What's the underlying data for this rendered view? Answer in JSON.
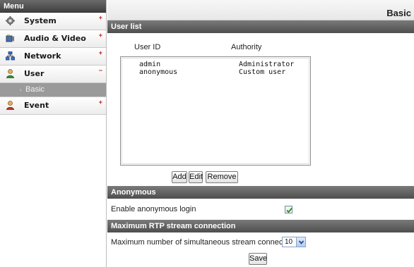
{
  "menu": {
    "header": "Menu",
    "items": [
      {
        "label": "System",
        "sign": "+",
        "icon": "gear-icon"
      },
      {
        "label": "Audio & Video",
        "sign": "+",
        "icon": "video-icon"
      },
      {
        "label": "Network",
        "sign": "+",
        "icon": "network-icon"
      },
      {
        "label": "User",
        "sign": "−",
        "icon": "user-icon"
      },
      {
        "label": "Event",
        "sign": "+",
        "icon": "event-icon"
      }
    ],
    "submenu": {
      "label": "Basic",
      "arrow": "›"
    }
  },
  "page": {
    "title": "Basic"
  },
  "user_list": {
    "section_title": "User list",
    "col_userid": "User ID",
    "col_authority": "Authority",
    "rows": [
      {
        "user_id": "admin",
        "authority": "Administrator"
      },
      {
        "user_id": "anonymous",
        "authority": "Custom user"
      }
    ],
    "buttons": {
      "add": "Add",
      "edit": "Edit",
      "remove": "Remove"
    }
  },
  "anonymous": {
    "section_title": "Anonymous",
    "label": "Enable anonymous login",
    "checked": true
  },
  "rtp": {
    "section_title": "Maximum RTP stream connection",
    "label": "Maximum number of simultaneous stream connection:",
    "value": "10",
    "save_label": "Save"
  },
  "colors": {
    "menu_sign": "#c41a1a",
    "section_bar": "#5a5a5a",
    "submenu_active": "#9a9a9a",
    "checkmark": "#2a8a2a"
  }
}
